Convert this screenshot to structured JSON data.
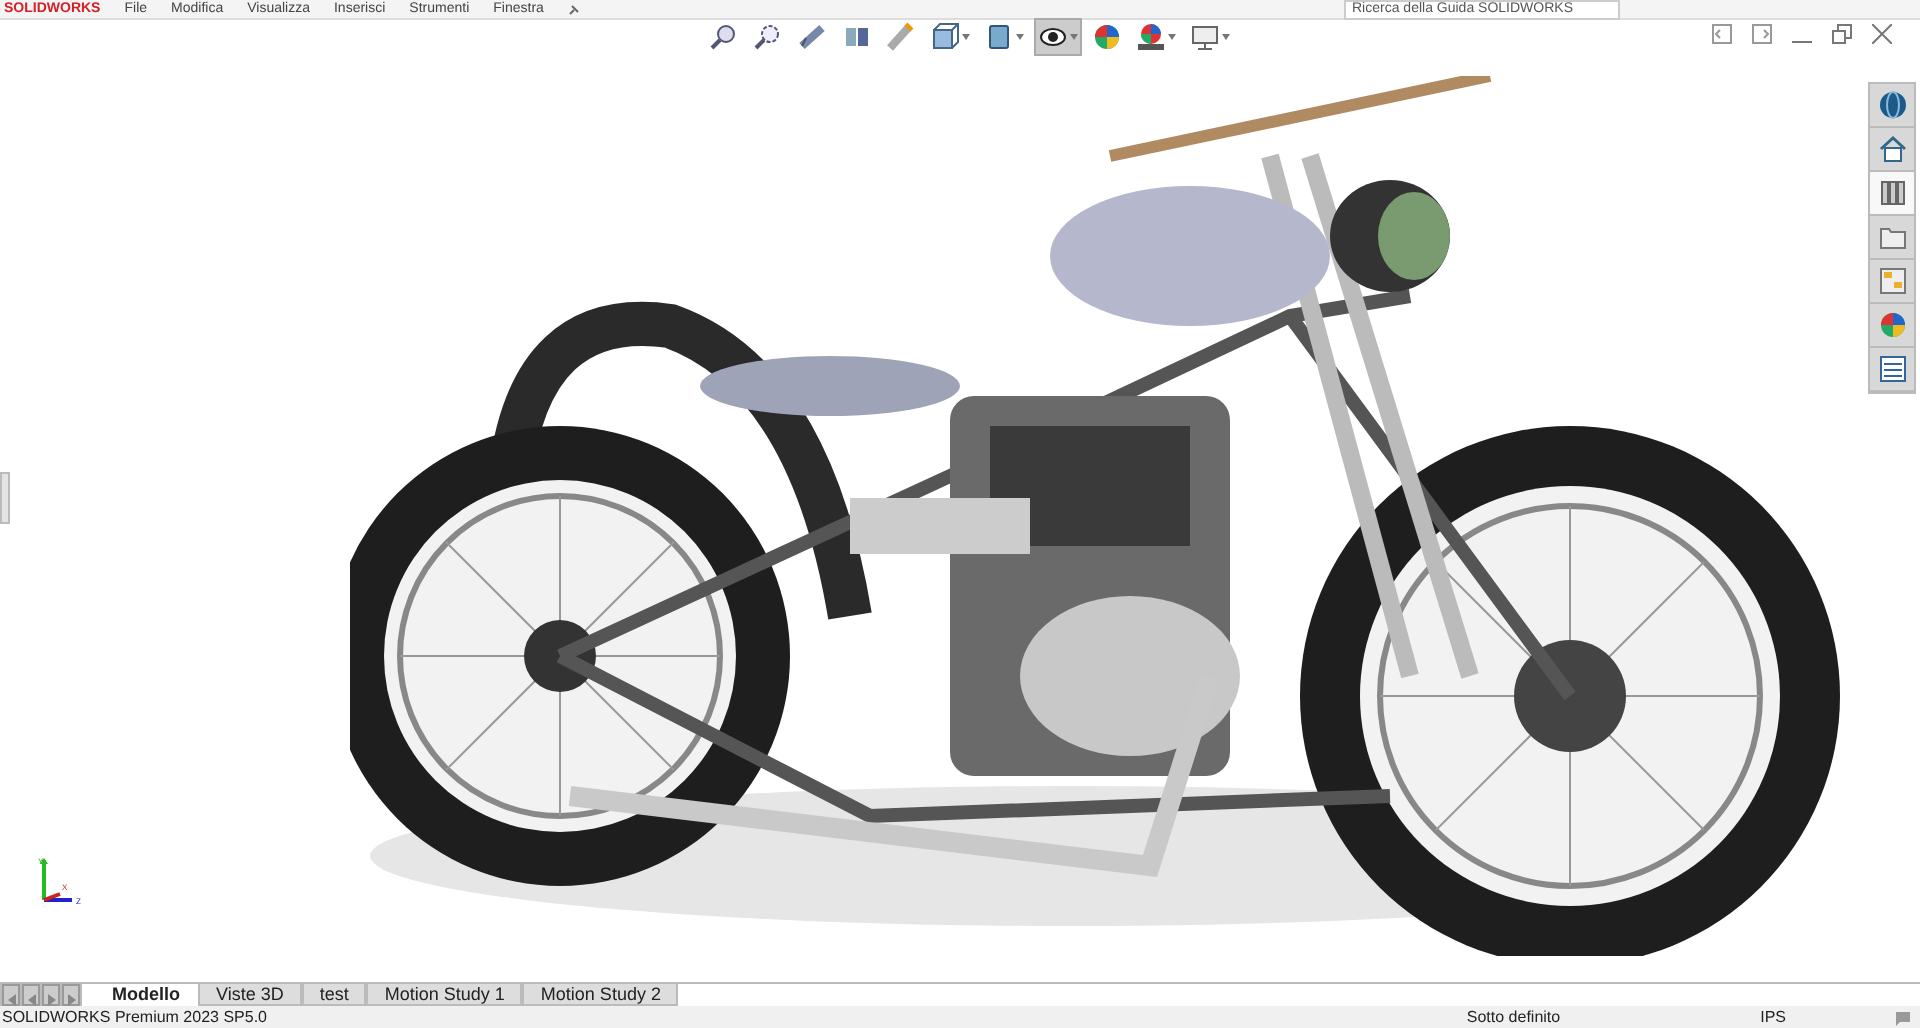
{
  "menu_bar": {
    "logo": "SOLIDWORKS",
    "items": [
      "File",
      "Modifica",
      "Visualizza",
      "Inserisci",
      "Strumenti",
      "Finestra"
    ],
    "search": {
      "placeholder": "Ricerca della Guida SOLIDWORKS"
    }
  },
  "view_toolbar": [
    {
      "selected": false,
      "dropdown": false
    },
    {
      "selected": false,
      "dropdown": false
    },
    {
      "selected": false,
      "dropdown": false
    },
    {
      "selected": false,
      "dropdown": false
    },
    {
      "selected": false,
      "dropdown": false
    },
    {
      "selected": false,
      "dropdown": true
    },
    {
      "selected": false,
      "dropdown": true
    },
    {
      "selected": true,
      "dropdown": true
    },
    {
      "selected": false,
      "dropdown": false
    },
    {
      "selected": false,
      "dropdown": true
    },
    {
      "selected": false,
      "dropdown": true
    }
  ],
  "task_pane": [
    {
      "selected": false
    },
    {
      "selected": false
    },
    {
      "selected": true
    },
    {
      "selected": false
    },
    {
      "selected": false
    },
    {
      "selected": false
    },
    {
      "selected": false
    }
  ],
  "triad": {
    "y_label": "Y",
    "x_label": "X",
    "z_label": "Z"
  },
  "tabs": [
    {
      "label": "Modello",
      "selected": true
    },
    {
      "label": "Viste 3D",
      "selected": false
    },
    {
      "label": "test",
      "selected": false
    },
    {
      "label": "Motion Study 1",
      "selected": false
    },
    {
      "label": "Motion Study 2",
      "selected": false
    }
  ],
  "status_bar": {
    "product": "SOLIDWORKS Premium 2023 SP5.0",
    "status": "Sotto definito",
    "units": "IPS"
  }
}
